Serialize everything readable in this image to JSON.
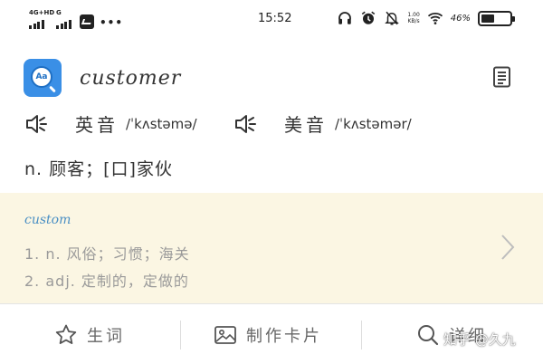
{
  "status_bar": {
    "network1": "4G+HD",
    "network2": "G",
    "more": "•••",
    "time": "15:52",
    "speed_value": "1.00",
    "speed_unit": "KB/s",
    "battery_text": "46%",
    "battery_level": 0.46
  },
  "entry": {
    "word": "customer",
    "uk_label": "英音",
    "uk_ipa": "/ˈkʌstəmə/",
    "us_label": "美音",
    "us_ipa": "/ˈkʌstəmər/",
    "definition": "n. 顾客；[口]家伙"
  },
  "related": {
    "word": "custom",
    "defs": [
      "1. n. 风俗；习惯；海关",
      "2. adj. 定制的，定做的"
    ]
  },
  "toolbar": {
    "vocab_label": "生词",
    "card_label": "制作卡片",
    "detail_label": "详细"
  },
  "watermark": "知乎 @久九",
  "colors": {
    "accent": "#3a8fe6",
    "related_bg": "#fbf6e3",
    "related_word": "#4a8fc4"
  }
}
